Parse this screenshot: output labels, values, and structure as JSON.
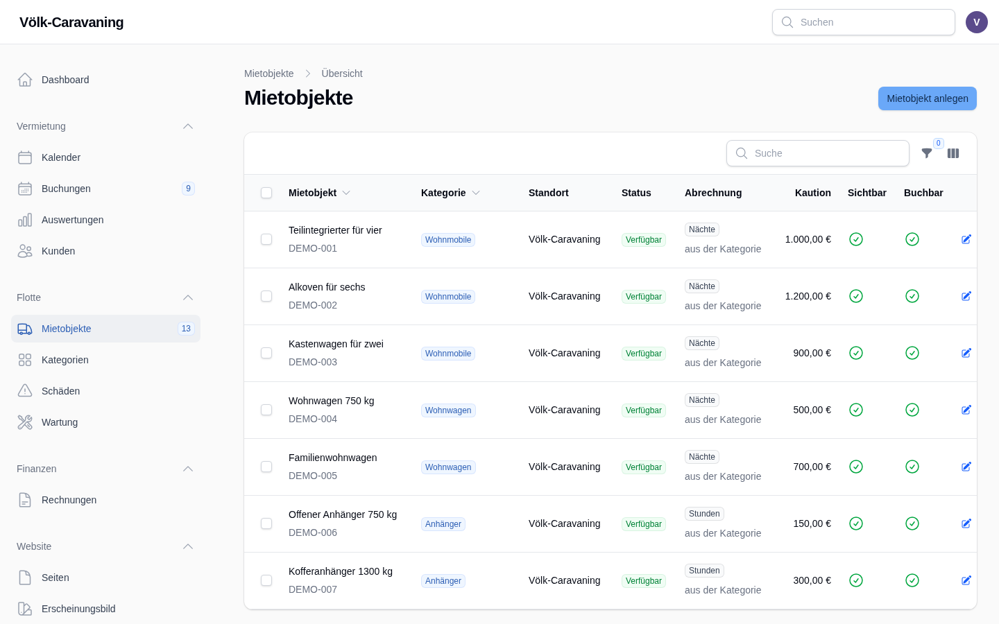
{
  "header": {
    "logo": "Völk-Caravaning",
    "search": {
      "placeholder": "Suchen"
    },
    "avatar": "V"
  },
  "sidebar": {
    "top_items": [
      {
        "label": "Dashboard",
        "selected": false
      }
    ],
    "groups": [
      {
        "label": "Vermietung",
        "expanded": true,
        "items": [
          {
            "label": "Kalender",
            "selected": false
          },
          {
            "label": "Buchungen",
            "badge": "9",
            "selected": false
          },
          {
            "label": "Auswertungen",
            "selected": false
          },
          {
            "label": "Kunden",
            "selected": false
          }
        ]
      },
      {
        "label": "Flotte",
        "expanded": true,
        "items": [
          {
            "label": "Mietobjekte",
            "badge": "13",
            "selected": true
          },
          {
            "label": "Kategorien",
            "selected": false
          },
          {
            "label": "Schäden",
            "selected": false
          },
          {
            "label": "Wartung",
            "selected": false
          }
        ]
      },
      {
        "label": "Finanzen",
        "expanded": true,
        "items": [
          {
            "label": "Rechnungen",
            "selected": false
          }
        ]
      },
      {
        "label": "Website",
        "expanded": true,
        "items": [
          {
            "label": "Seiten",
            "selected": false
          },
          {
            "label": "Erscheinungsbild",
            "selected": false
          }
        ]
      }
    ]
  },
  "breadcrumbs": [
    "Mietobjekte",
    "Übersicht"
  ],
  "page_title": "Mietobjekte",
  "create_button": "Mietobjekt anlegen",
  "table": {
    "search": {
      "placeholder": "Suche"
    },
    "filter_count": "0",
    "select_all": {
      "checked": false
    },
    "columns": [
      {
        "label": "Mietobjekt",
        "sortable": true
      },
      {
        "label": "Kategorie",
        "sortable": true
      },
      {
        "label": "Standort",
        "sortable": false
      },
      {
        "label": "Status",
        "sortable": false
      },
      {
        "label": "Abrechnung",
        "sortable": false
      },
      {
        "label": "Kaution",
        "sortable": false
      },
      {
        "label": "Sichtbar",
        "sortable": false
      },
      {
        "label": "Buchbar",
        "sortable": false
      }
    ],
    "rows": [
      {
        "name": "Teilintegrierter für vier",
        "code": "DEMO-001",
        "category": "Wohnmobile",
        "location": "Völk-Caravaning",
        "status": "Verfügbar",
        "billing_unit": "Nächte",
        "billing_note": "aus der Kategorie",
        "deposit": "1.000,00 €",
        "visible": true,
        "bookable": true,
        "checked": false
      },
      {
        "name": "Alkoven für sechs",
        "code": "DEMO-002",
        "category": "Wohnmobile",
        "location": "Völk-Caravaning",
        "status": "Verfügbar",
        "billing_unit": "Nächte",
        "billing_note": "aus der Kategorie",
        "deposit": "1.200,00 €",
        "visible": true,
        "bookable": true,
        "checked": false
      },
      {
        "name": "Kastenwagen für zwei",
        "code": "DEMO-003",
        "category": "Wohnmobile",
        "location": "Völk-Caravaning",
        "status": "Verfügbar",
        "billing_unit": "Nächte",
        "billing_note": "aus der Kategorie",
        "deposit": "900,00 €",
        "visible": true,
        "bookable": true,
        "checked": false
      },
      {
        "name": "Wohnwagen 750 kg",
        "code": "DEMO-004",
        "category": "Wohnwagen",
        "location": "Völk-Caravaning",
        "status": "Verfügbar",
        "billing_unit": "Nächte",
        "billing_note": "aus der Kategorie",
        "deposit": "500,00 €",
        "visible": true,
        "bookable": true,
        "checked": false
      },
      {
        "name": "Familienwohnwagen",
        "code": "DEMO-005",
        "category": "Wohnwagen",
        "location": "Völk-Caravaning",
        "status": "Verfügbar",
        "billing_unit": "Nächte",
        "billing_note": "aus der Kategorie",
        "deposit": "700,00 €",
        "visible": true,
        "bookable": true,
        "checked": false
      },
      {
        "name": "Offener Anhänger 750 kg",
        "code": "DEMO-006",
        "category": "Anhänger",
        "location": "Völk-Caravaning",
        "status": "Verfügbar",
        "billing_unit": "Stunden",
        "billing_note": "aus der Kategorie",
        "deposit": "150,00 €",
        "visible": true,
        "bookable": true,
        "checked": false
      },
      {
        "name": "Kofferanhänger 1300 kg",
        "code": "DEMO-007",
        "category": "Anhänger",
        "location": "Völk-Caravaning",
        "status": "Verfügbar",
        "billing_unit": "Stunden",
        "billing_note": "aus der Kategorie",
        "deposit": "300,00 €",
        "visible": true,
        "bookable": true,
        "checked": false
      }
    ]
  }
}
